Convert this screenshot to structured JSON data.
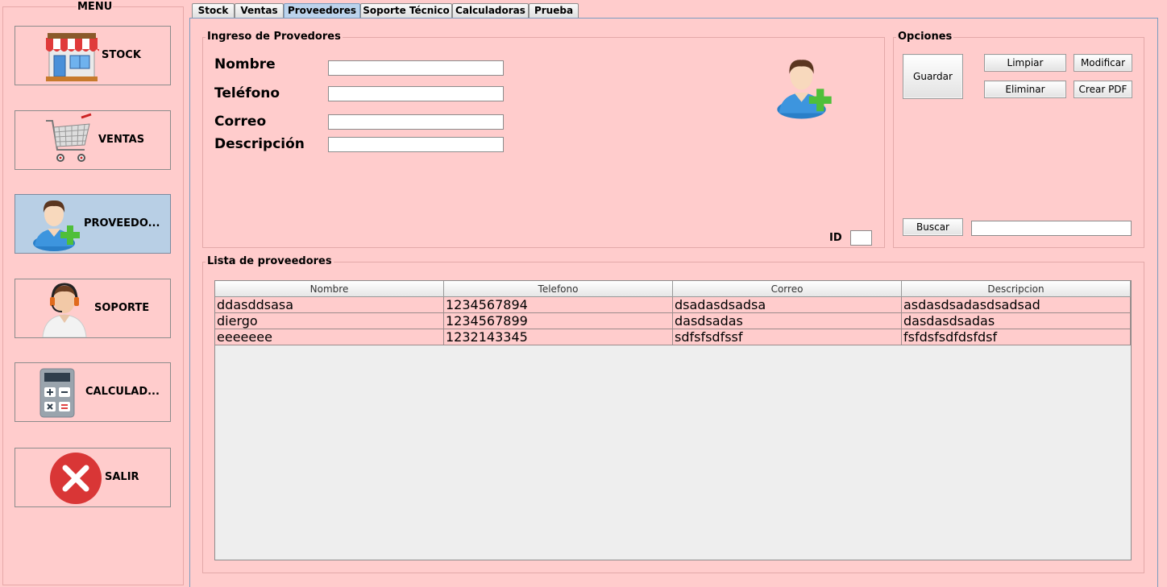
{
  "menu": {
    "title": "MENU",
    "items": [
      {
        "label": "STOCK",
        "icon": "store-icon"
      },
      {
        "label": "VENTAS",
        "icon": "shopping-cart-icon"
      },
      {
        "label": "PROVEEDO...",
        "icon": "add-user-icon"
      },
      {
        "label": "SOPORTE",
        "icon": "support-agent-icon"
      },
      {
        "label": "CALCULAD...",
        "icon": "calculator-icon"
      },
      {
        "label": "SALIR",
        "icon": "exit-x-icon"
      }
    ]
  },
  "tabs": [
    "Stock",
    "Ventas",
    "Proveedores",
    "Soporte Técnico",
    "Calculadoras",
    "Prueba"
  ],
  "selected_tab": "Proveedores",
  "ingreso": {
    "title": "Ingreso de Provedores",
    "fields": [
      {
        "label": "Nombre",
        "value": ""
      },
      {
        "label": "Teléfono",
        "value": ""
      },
      {
        "label": "Correo",
        "value": ""
      },
      {
        "label": "Descripción",
        "value": ""
      }
    ],
    "id_label": "ID",
    "id_value": ""
  },
  "opciones": {
    "title": "Opciones",
    "guardar": "Guardar",
    "limpiar": "Limpiar",
    "modificar": "Modificar",
    "eliminar": "Eliminar",
    "crear_pdf": "Crear PDF",
    "buscar": "Buscar",
    "buscar_value": ""
  },
  "lista": {
    "title": "Lista de proveedores",
    "columns": [
      "Nombre",
      "Telefono",
      "Correo",
      "Descripcion"
    ],
    "rows": [
      [
        "ddasddsasa",
        "1234567894",
        "dsadasdsadsa",
        "asdasdsadasdsadsad"
      ],
      [
        "diergo",
        "1234567899",
        "dasdsadas",
        "dasdasdsadas"
      ],
      [
        "eeeeeee",
        "1232143345",
        "sdfsfsdfssf",
        "fsfdsfsdfdsfdsf"
      ]
    ]
  },
  "colors": {
    "background": "#ffcccc",
    "selected": "#b8cfe5",
    "table_bg": "#eeeeee"
  }
}
